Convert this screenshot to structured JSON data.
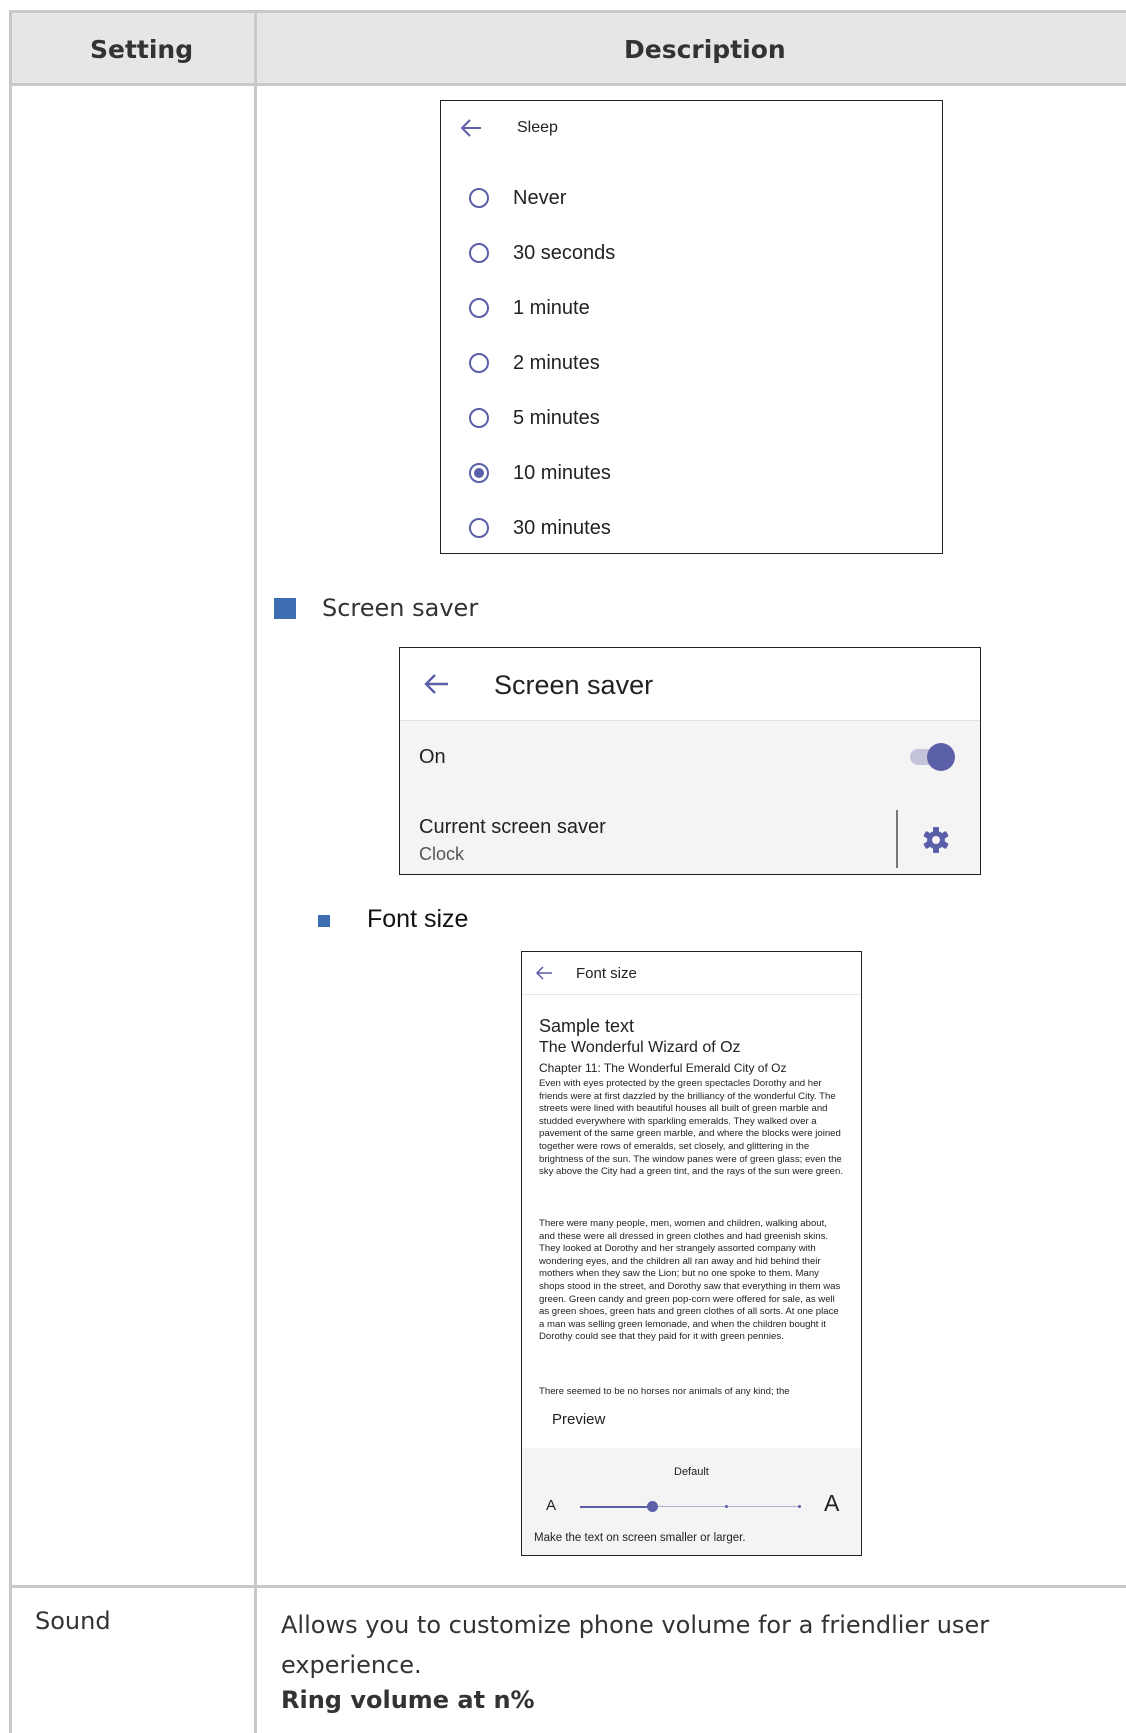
{
  "table": {
    "col_setting": "Setting",
    "col_description": "Description"
  },
  "sleep": {
    "title": "Sleep",
    "options": [
      "Never",
      "30 seconds",
      "1 minute",
      "2 minutes",
      "5 minutes",
      "10 minutes",
      "30 minutes"
    ],
    "selected": "10 minutes"
  },
  "screen_saver": {
    "bullet": "Screen saver",
    "title": "Screen saver",
    "on_label": "On",
    "on_state": true,
    "current_label": "Current screen saver",
    "current_value": "Clock"
  },
  "font_size": {
    "bullet": "Font size",
    "title": "Font size",
    "sample_title": "Sample text",
    "book_title": "The Wonderful Wizard of Oz",
    "chapter": "Chapter 11: The Wonderful Emerald City of Oz",
    "para1": "Even with eyes protected by the green spectacles Dorothy and her friends were at first dazzled by the brilliancy of the wonderful City. The streets were lined with beautiful houses all built of green marble and studded everywhere with sparkling emeralds. They walked over a pavement of the same green marble, and where the blocks were joined together were rows of emeralds, set closely, and glittering in the brightness of the sun. The window panes were of green glass; even the sky above the City had a green tint, and the rays of the sun were green.",
    "para2": "There were many people, men, women and children, walking about, and these were all dressed in green clothes and had greenish skins. They looked at Dorothy and her strangely assorted company with wondering eyes, and the children all ran away and hid behind their mothers when they saw the Lion; but no one spoke to them. Many shops stood in the street, and Dorothy saw that everything in them was green. Green candy and green pop-corn were offered for sale, as well as green shoes, green hats and green clothes of all sorts. At one place a man was selling green lemonade, and when the children bought it Dorothy could see that they paid for it with green pennies.",
    "para3": "There seemed to be no horses nor animals of any kind; the",
    "preview": "Preview",
    "slider_label": "Default",
    "small_a": "A",
    "large_a": "A",
    "hint": "Make the text on screen smaller or larger."
  },
  "sound_row": {
    "setting": "Sound",
    "description": "Allows you to customize phone volume for a friendlier user experience.",
    "bold": "Ring volume at n%"
  },
  "colors": {
    "accent": "#5b5fa8",
    "bullet": "#3b6db0",
    "header_bg": "#e6e6e6",
    "grid": "#c9c9c9"
  }
}
